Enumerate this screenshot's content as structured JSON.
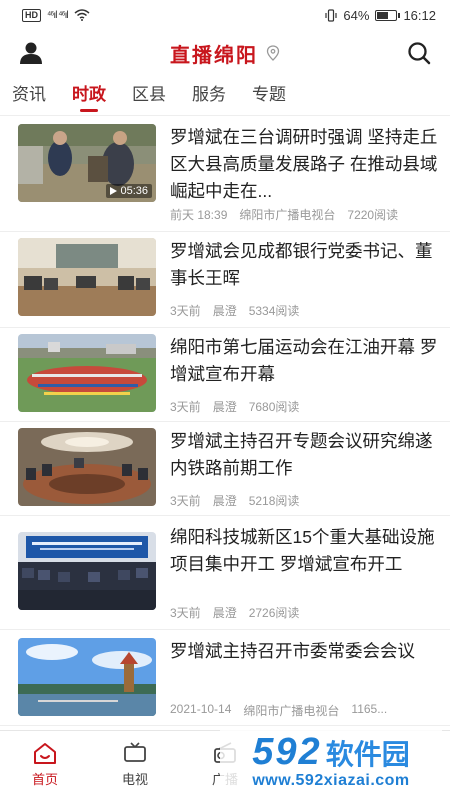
{
  "status_bar": {
    "carrier_badge": "HD",
    "signal_text": "⁴⁶ıl ⁴⁶ıl",
    "battery_percent_text": "64%",
    "battery_level": 0.64,
    "time": "16:12"
  },
  "header": {
    "title": "直播绵阳",
    "icons": {
      "left": "user-icon",
      "right": "search-icon",
      "title_suffix": "location-pin-icon"
    }
  },
  "tabs": [
    {
      "label": "资讯",
      "active": false
    },
    {
      "label": "时政",
      "active": true
    },
    {
      "label": "区县",
      "active": false
    },
    {
      "label": "服务",
      "active": false
    },
    {
      "label": "专题",
      "active": false
    }
  ],
  "news": [
    {
      "title": "罗增斌在三台调研时强调 坚持走丘区大县高质量发展路子 在推动县域崛起中走在...",
      "time": "前天 18:39",
      "source": "绵阳市广播电视台",
      "reads": "7220阅读",
      "duration": "05:36"
    },
    {
      "title": "罗增斌会见成都银行党委书记、董事长王晖",
      "time": "3天前",
      "source": "晨澄",
      "reads": "5334阅读"
    },
    {
      "title": "绵阳市第七届运动会在江油开幕 罗增斌宣布开幕",
      "time": "3天前",
      "source": "晨澄",
      "reads": "7680阅读"
    },
    {
      "title": "罗增斌主持召开专题会议研究绵遂内铁路前期工作",
      "time": "3天前",
      "source": "晨澄",
      "reads": "5218阅读"
    },
    {
      "title": "绵阳科技城新区15个重大基础设施项目集中开工 罗增斌宣布开工",
      "time": "3天前",
      "source": "晨澄",
      "reads": "2726阅读"
    },
    {
      "title": "罗增斌主持召开市委常委会会议",
      "time": "2021-10-14",
      "source": "绵阳市广播电视台",
      "reads": "1165..."
    }
  ],
  "tab_bar": [
    {
      "label": "首页",
      "icon": "home-icon",
      "active": true
    },
    {
      "label": "电视",
      "icon": "tv-icon",
      "active": false
    },
    {
      "label": "广播",
      "icon": "radio-icon",
      "active": false
    }
  ],
  "watermark": {
    "number": "592",
    "text": "软件园",
    "url": "www.592xiazai.com"
  },
  "colors": {
    "brand_red": "#c8161d",
    "watermark_blue": "#1f7fd4"
  }
}
